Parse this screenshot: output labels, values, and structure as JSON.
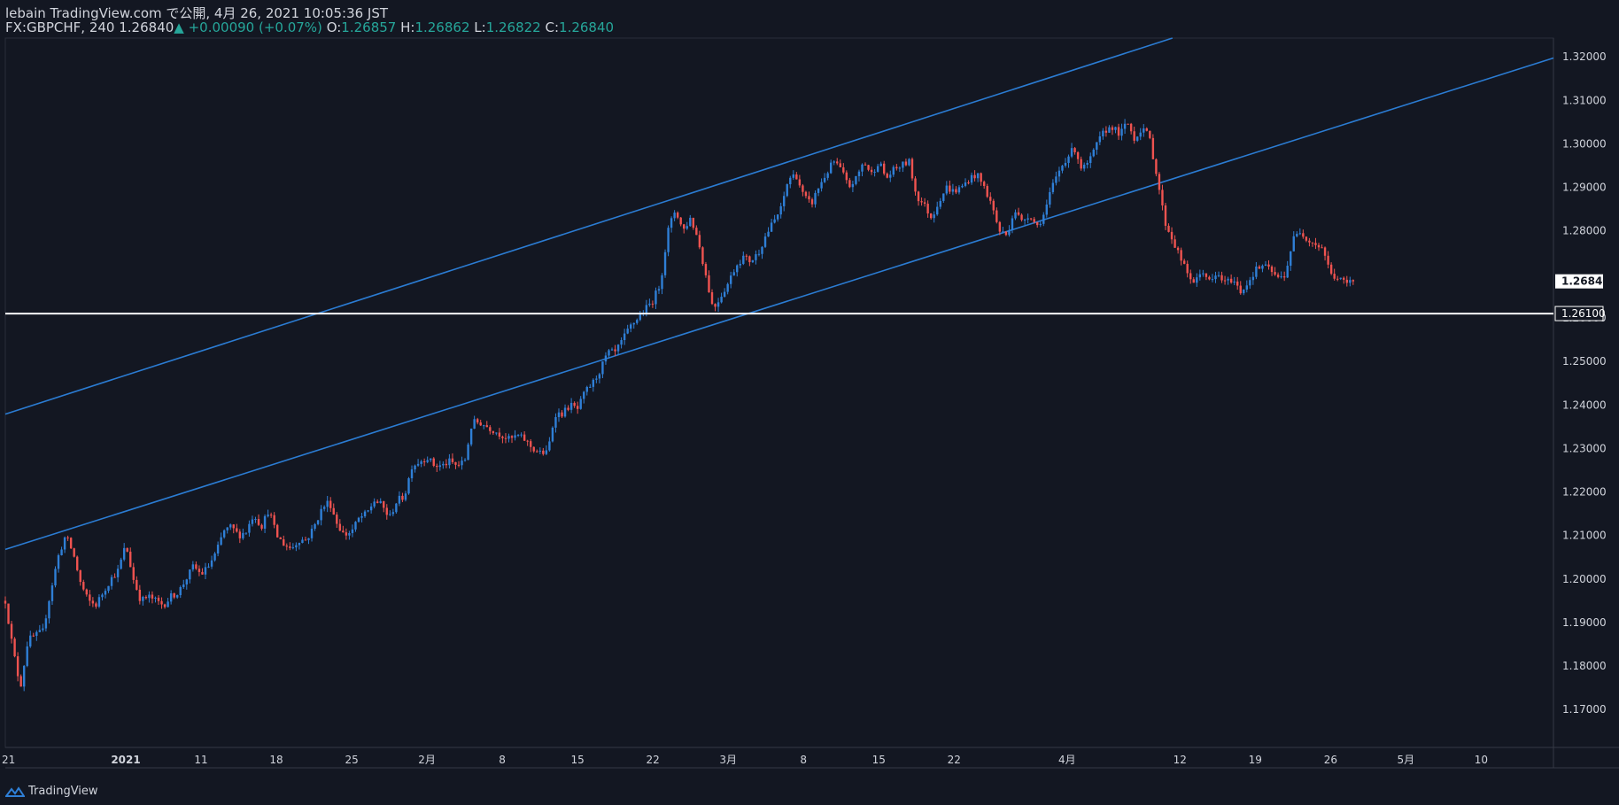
{
  "header": {
    "line1": "lebain TradingView.com で公開, 4月 26, 2021 10:05:36 JST",
    "symbol": "FX:GBPCHF, 240",
    "last": "1.26840",
    "change_arrow": "▲",
    "change": "+0.00090 (+0.07%)",
    "o_label": "O:",
    "o_value": "1.26857",
    "h_label": "H:",
    "h_value": "1.26862",
    "l_label": "L:",
    "l_value": "1.26822",
    "c_label": "C:",
    "c_value": "1.26840"
  },
  "footer": {
    "brand": "TradingView",
    "icon": "tradingview-logo-icon"
  },
  "colors": {
    "background": "#131722",
    "up": "#2f7fd6",
    "down": "#ef5350",
    "channel": "#2b7cd3",
    "support": "#ffffff",
    "axis_text": "#d1d4dc",
    "grid_border": "#2a2e39",
    "last_price_bg": "#ffffff",
    "last_price_text": "#131722"
  },
  "chart_data": {
    "type": "candlestick",
    "ylim": [
      1.1613,
      1.3243
    ],
    "yticks": [
      "1.17000",
      "1.18000",
      "1.19000",
      "1.20000",
      "1.21000",
      "1.22000",
      "1.23000",
      "1.24000",
      "1.25000",
      "1.26000",
      "1.27000",
      "1.28000",
      "1.29000",
      "1.30000",
      "1.31000",
      "1.32000"
    ],
    "xlim": [
      0,
      205.6
    ],
    "xticks": [
      {
        "label": "21",
        "i": 0
      },
      {
        "label": "2021",
        "i": 16
      },
      {
        "label": "11",
        "i": 26
      },
      {
        "label": "18",
        "i": 36
      },
      {
        "label": "25",
        "i": 46
      },
      {
        "label": "2月",
        "i": 56
      },
      {
        "label": "8",
        "i": 66
      },
      {
        "label": "15",
        "i": 76
      },
      {
        "label": "22",
        "i": 86
      },
      {
        "label": "3月",
        "i": 96
      },
      {
        "label": "8",
        "i": 106
      },
      {
        "label": "15",
        "i": 116
      },
      {
        "label": "22",
        "i": 126
      },
      {
        "label": "4月",
        "i": 141
      },
      {
        "label": "12",
        "i": 156
      },
      {
        "label": "19",
        "i": 166
      },
      {
        "label": "26",
        "i": 176
      },
      {
        "label": "5月",
        "i": 186
      },
      {
        "label": "10",
        "i": 196
      }
    ],
    "last_price": "1.26840",
    "support_label": "1.26100",
    "support_level": 1.261,
    "channel_lines": [
      {
        "name": "upper",
        "i1": 0,
        "p1": 1.2379,
        "i2": 155,
        "p2": 1.3243
      },
      {
        "name": "lower",
        "i1": 0,
        "p1": 1.2068,
        "i2": 205,
        "p2": 1.3194
      }
    ],
    "anchors": [
      [
        0,
        1.195
      ],
      [
        1,
        1.184
      ],
      [
        2,
        1.175
      ],
      [
        3,
        1.186
      ],
      [
        5,
        1.188
      ],
      [
        6,
        1.197
      ],
      [
        7,
        1.205
      ],
      [
        8,
        1.21
      ],
      [
        9,
        1.206
      ],
      [
        10,
        1.199
      ],
      [
        11,
        1.195
      ],
      [
        12,
        1.194
      ],
      [
        13,
        1.197
      ],
      [
        14,
        1.2
      ],
      [
        15,
        1.202
      ],
      [
        16,
        1.208
      ],
      [
        17,
        1.2
      ],
      [
        18,
        1.195
      ],
      [
        19,
        1.196
      ],
      [
        20,
        1.195
      ],
      [
        21,
        1.194
      ],
      [
        22,
        1.196
      ],
      [
        23,
        1.197
      ],
      [
        24,
        1.2
      ],
      [
        25,
        1.203
      ],
      [
        26,
        1.201
      ],
      [
        27,
        1.203
      ],
      [
        28,
        1.206
      ],
      [
        29,
        1.211
      ],
      [
        30,
        1.212
      ],
      [
        31,
        1.21
      ],
      [
        32,
        1.211
      ],
      [
        33,
        1.215
      ],
      [
        34,
        1.212
      ],
      [
        35,
        1.216
      ],
      [
        36,
        1.21
      ],
      [
        37,
        1.208
      ],
      [
        38,
        1.207
      ],
      [
        39,
        1.209
      ],
      [
        40,
        1.209
      ],
      [
        41,
        1.212
      ],
      [
        42,
        1.216
      ],
      [
        43,
        1.218
      ],
      [
        44,
        1.213
      ],
      [
        45,
        1.21
      ],
      [
        46,
        1.211
      ],
      [
        47,
        1.214
      ],
      [
        48,
        1.215
      ],
      [
        49,
        1.218
      ],
      [
        50,
        1.217
      ],
      [
        51,
        1.214
      ],
      [
        52,
        1.218
      ],
      [
        53,
        1.219
      ],
      [
        54,
        1.226
      ],
      [
        55,
        1.227
      ],
      [
        56,
        1.228
      ],
      [
        57,
        1.226
      ],
      [
        58,
        1.226
      ],
      [
        59,
        1.227
      ],
      [
        60,
        1.226
      ],
      [
        61,
        1.227
      ],
      [
        62,
        1.236
      ],
      [
        63,
        1.236
      ],
      [
        64,
        1.235
      ],
      [
        65,
        1.234
      ],
      [
        66,
        1.233
      ],
      [
        67,
        1.232
      ],
      [
        68,
        1.233
      ],
      [
        69,
        1.232
      ],
      [
        70,
        1.23
      ],
      [
        71,
        1.229
      ],
      [
        72,
        1.229
      ],
      [
        73,
        1.238
      ],
      [
        74,
        1.238
      ],
      [
        75,
        1.24
      ],
      [
        76,
        1.239
      ],
      [
        77,
        1.243
      ],
      [
        78,
        1.245
      ],
      [
        79,
        1.248
      ],
      [
        80,
        1.252
      ],
      [
        81,
        1.252
      ],
      [
        82,
        1.255
      ],
      [
        83,
        1.258
      ],
      [
        84,
        1.26
      ],
      [
        85,
        1.262
      ],
      [
        86,
        1.264
      ],
      [
        87,
        1.268
      ],
      [
        88,
        1.28
      ],
      [
        89,
        1.285
      ],
      [
        90,
        1.28
      ],
      [
        91,
        1.283
      ],
      [
        92,
        1.278
      ],
      [
        93,
        1.27
      ],
      [
        94,
        1.262
      ],
      [
        95,
        1.265
      ],
      [
        96,
        1.268
      ],
      [
        97,
        1.272
      ],
      [
        98,
        1.274
      ],
      [
        99,
        1.273
      ],
      [
        100,
        1.275
      ],
      [
        101,
        1.279
      ],
      [
        102,
        1.282
      ],
      [
        103,
        1.285
      ],
      [
        104,
        1.292
      ],
      [
        105,
        1.293
      ],
      [
        106,
        1.288
      ],
      [
        107,
        1.286
      ],
      [
        108,
        1.29
      ],
      [
        109,
        1.293
      ],
      [
        110,
        1.296
      ],
      [
        111,
        1.294
      ],
      [
        112,
        1.29
      ],
      [
        113,
        1.292
      ],
      [
        114,
        1.296
      ],
      [
        115,
        1.293
      ],
      [
        116,
        1.296
      ],
      [
        117,
        1.292
      ],
      [
        118,
        1.294
      ],
      [
        119,
        1.295
      ],
      [
        120,
        1.296
      ],
      [
        121,
        1.288
      ],
      [
        122,
        1.286
      ],
      [
        123,
        1.283
      ],
      [
        124,
        1.287
      ],
      [
        125,
        1.29
      ],
      [
        126,
        1.289
      ],
      [
        127,
        1.29
      ],
      [
        128,
        1.292
      ],
      [
        129,
        1.293
      ],
      [
        130,
        1.29
      ],
      [
        131,
        1.286
      ],
      [
        132,
        1.28
      ],
      [
        133,
        1.279
      ],
      [
        134,
        1.285
      ],
      [
        135,
        1.282
      ],
      [
        136,
        1.284
      ],
      [
        137,
        1.281
      ],
      [
        138,
        1.284
      ],
      [
        139,
        1.29
      ],
      [
        140,
        1.294
      ],
      [
        141,
        1.297
      ],
      [
        142,
        1.299
      ],
      [
        143,
        1.294
      ],
      [
        144,
        1.296
      ],
      [
        145,
        1.3
      ],
      [
        146,
        1.303
      ],
      [
        147,
        1.304
      ],
      [
        148,
        1.302
      ],
      [
        149,
        1.305
      ],
      [
        150,
        1.301
      ],
      [
        151,
        1.304
      ],
      [
        152,
        1.301
      ],
      [
        153,
        1.292
      ],
      [
        154,
        1.282
      ],
      [
        155,
        1.278
      ],
      [
        156,
        1.274
      ],
      [
        157,
        1.27
      ],
      [
        158,
        1.268
      ],
      [
        159,
        1.271
      ],
      [
        160,
        1.268
      ],
      [
        161,
        1.27
      ],
      [
        162,
        1.268
      ],
      [
        163,
        1.269
      ],
      [
        164,
        1.266
      ],
      [
        165,
        1.268
      ],
      [
        166,
        1.271
      ],
      [
        167,
        1.272
      ],
      [
        168,
        1.271
      ],
      [
        169,
        1.269
      ],
      [
        170,
        1.27
      ],
      [
        171,
        1.278
      ],
      [
        172,
        1.28
      ],
      [
        173,
        1.278
      ],
      [
        174,
        1.277
      ],
      [
        175,
        1.276
      ],
      [
        176,
        1.27
      ],
      [
        177,
        1.269
      ],
      [
        178,
        1.268
      ],
      [
        179,
        1.2684
      ]
    ]
  }
}
